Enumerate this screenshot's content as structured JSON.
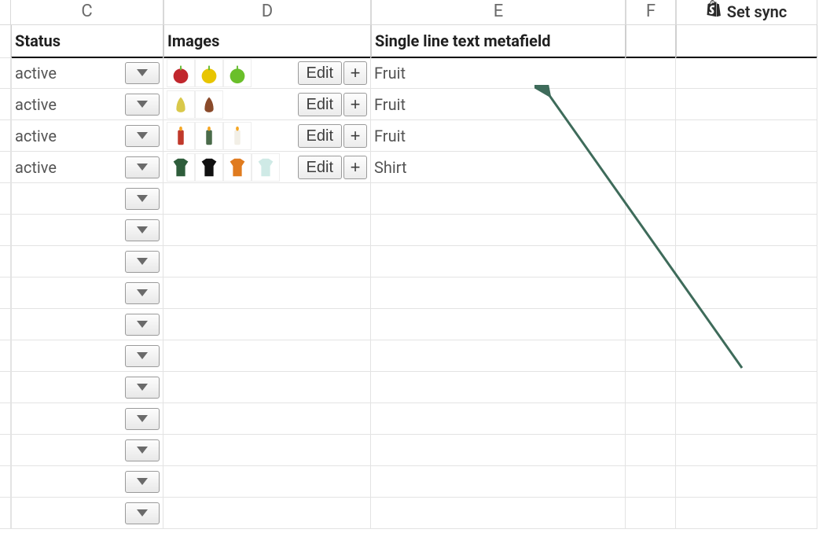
{
  "columns": {
    "c": "C",
    "d": "D",
    "e": "E",
    "f": "F",
    "sync_label": "Set sync"
  },
  "headers": {
    "status": "Status",
    "images": "Images",
    "metafield": "Single line text metafield"
  },
  "labels": {
    "edit": "Edit",
    "plus": "+"
  },
  "rows": [
    {
      "status": "active",
      "metafield": "Fruit",
      "images": "apples"
    },
    {
      "status": "active",
      "metafield": "Fruit",
      "images": "pears"
    },
    {
      "status": "active",
      "metafield": "Fruit",
      "images": "candles"
    },
    {
      "status": "active",
      "metafield": "Shirt",
      "images": "shirts"
    }
  ],
  "empty_rows": 11,
  "icons": {
    "dropdown": "chevron-down-icon",
    "shopify": "shopify-icon"
  }
}
